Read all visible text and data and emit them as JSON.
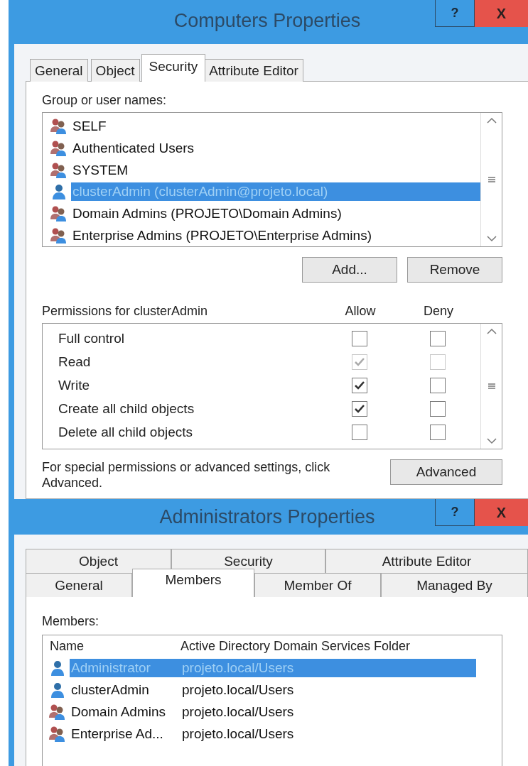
{
  "computers_dialog": {
    "title": "Computers Properties",
    "help_button": "?",
    "close_button": "X",
    "tabs": [
      {
        "label": "General",
        "selected": false
      },
      {
        "label": "Object",
        "selected": false
      },
      {
        "label": "Security",
        "selected": true
      },
      {
        "label": "Attribute Editor",
        "selected": false
      }
    ],
    "names_label": "Group or user names:",
    "names": [
      {
        "label": "SELF",
        "kind": "group",
        "selected": false
      },
      {
        "label": "Authenticated Users",
        "kind": "group",
        "selected": false
      },
      {
        "label": "SYSTEM",
        "kind": "group",
        "selected": false
      },
      {
        "label": "clusterAdmin (clusterAdmin@projeto.local)",
        "kind": "user",
        "selected": true
      },
      {
        "label": "Domain Admins (PROJETO\\Domain Admins)",
        "kind": "group",
        "selected": false
      },
      {
        "label": "Enterprise Admins (PROJETO\\Enterprise Admins)",
        "kind": "group",
        "selected": false
      }
    ],
    "add_button": "Add...",
    "remove_button": "Remove",
    "permissions_label": "Permissions for clusterAdmin",
    "allow_header": "Allow",
    "deny_header": "Deny",
    "permissions": [
      {
        "label": "Full control",
        "allow": {
          "checked": false,
          "disabled": false
        },
        "deny": {
          "checked": false,
          "disabled": false
        }
      },
      {
        "label": "Read",
        "allow": {
          "checked": true,
          "disabled": true
        },
        "deny": {
          "checked": false,
          "disabled": true
        }
      },
      {
        "label": "Write",
        "allow": {
          "checked": true,
          "disabled": false
        },
        "deny": {
          "checked": false,
          "disabled": false
        }
      },
      {
        "label": "Create all child objects",
        "allow": {
          "checked": true,
          "disabled": false
        },
        "deny": {
          "checked": false,
          "disabled": false
        }
      },
      {
        "label": "Delete all child objects",
        "allow": {
          "checked": false,
          "disabled": false
        },
        "deny": {
          "checked": false,
          "disabled": false
        }
      }
    ],
    "advanced_note": "For special permissions or advanced settings, click Advanced.",
    "advanced_button": "Advanced"
  },
  "administrators_dialog": {
    "title": "Administrators Properties",
    "help_button": "?",
    "close_button": "X",
    "tab_rows": [
      [
        {
          "label": "Object",
          "selected": false
        },
        {
          "label": "Security",
          "selected": false
        },
        {
          "label": "Attribute Editor",
          "selected": false
        }
      ],
      [
        {
          "label": "General",
          "selected": false
        },
        {
          "label": "Members",
          "selected": true
        },
        {
          "label": "Member Of",
          "selected": false
        },
        {
          "label": "Managed By",
          "selected": false
        }
      ]
    ],
    "members_label": "Members:",
    "columns": [
      "Name",
      "Active Directory Domain Services Folder"
    ],
    "members": [
      {
        "name": "Administrator",
        "folder": "projeto.local/Users",
        "kind": "user",
        "selected": true
      },
      {
        "name": "clusterAdmin",
        "folder": "projeto.local/Users",
        "kind": "user",
        "selected": false
      },
      {
        "name": "Domain Admins",
        "folder": "projeto.local/Users",
        "kind": "group",
        "selected": false
      },
      {
        "name": "Enterprise Ad...",
        "folder": "projeto.local/Users",
        "kind": "group",
        "selected": false
      }
    ]
  }
}
